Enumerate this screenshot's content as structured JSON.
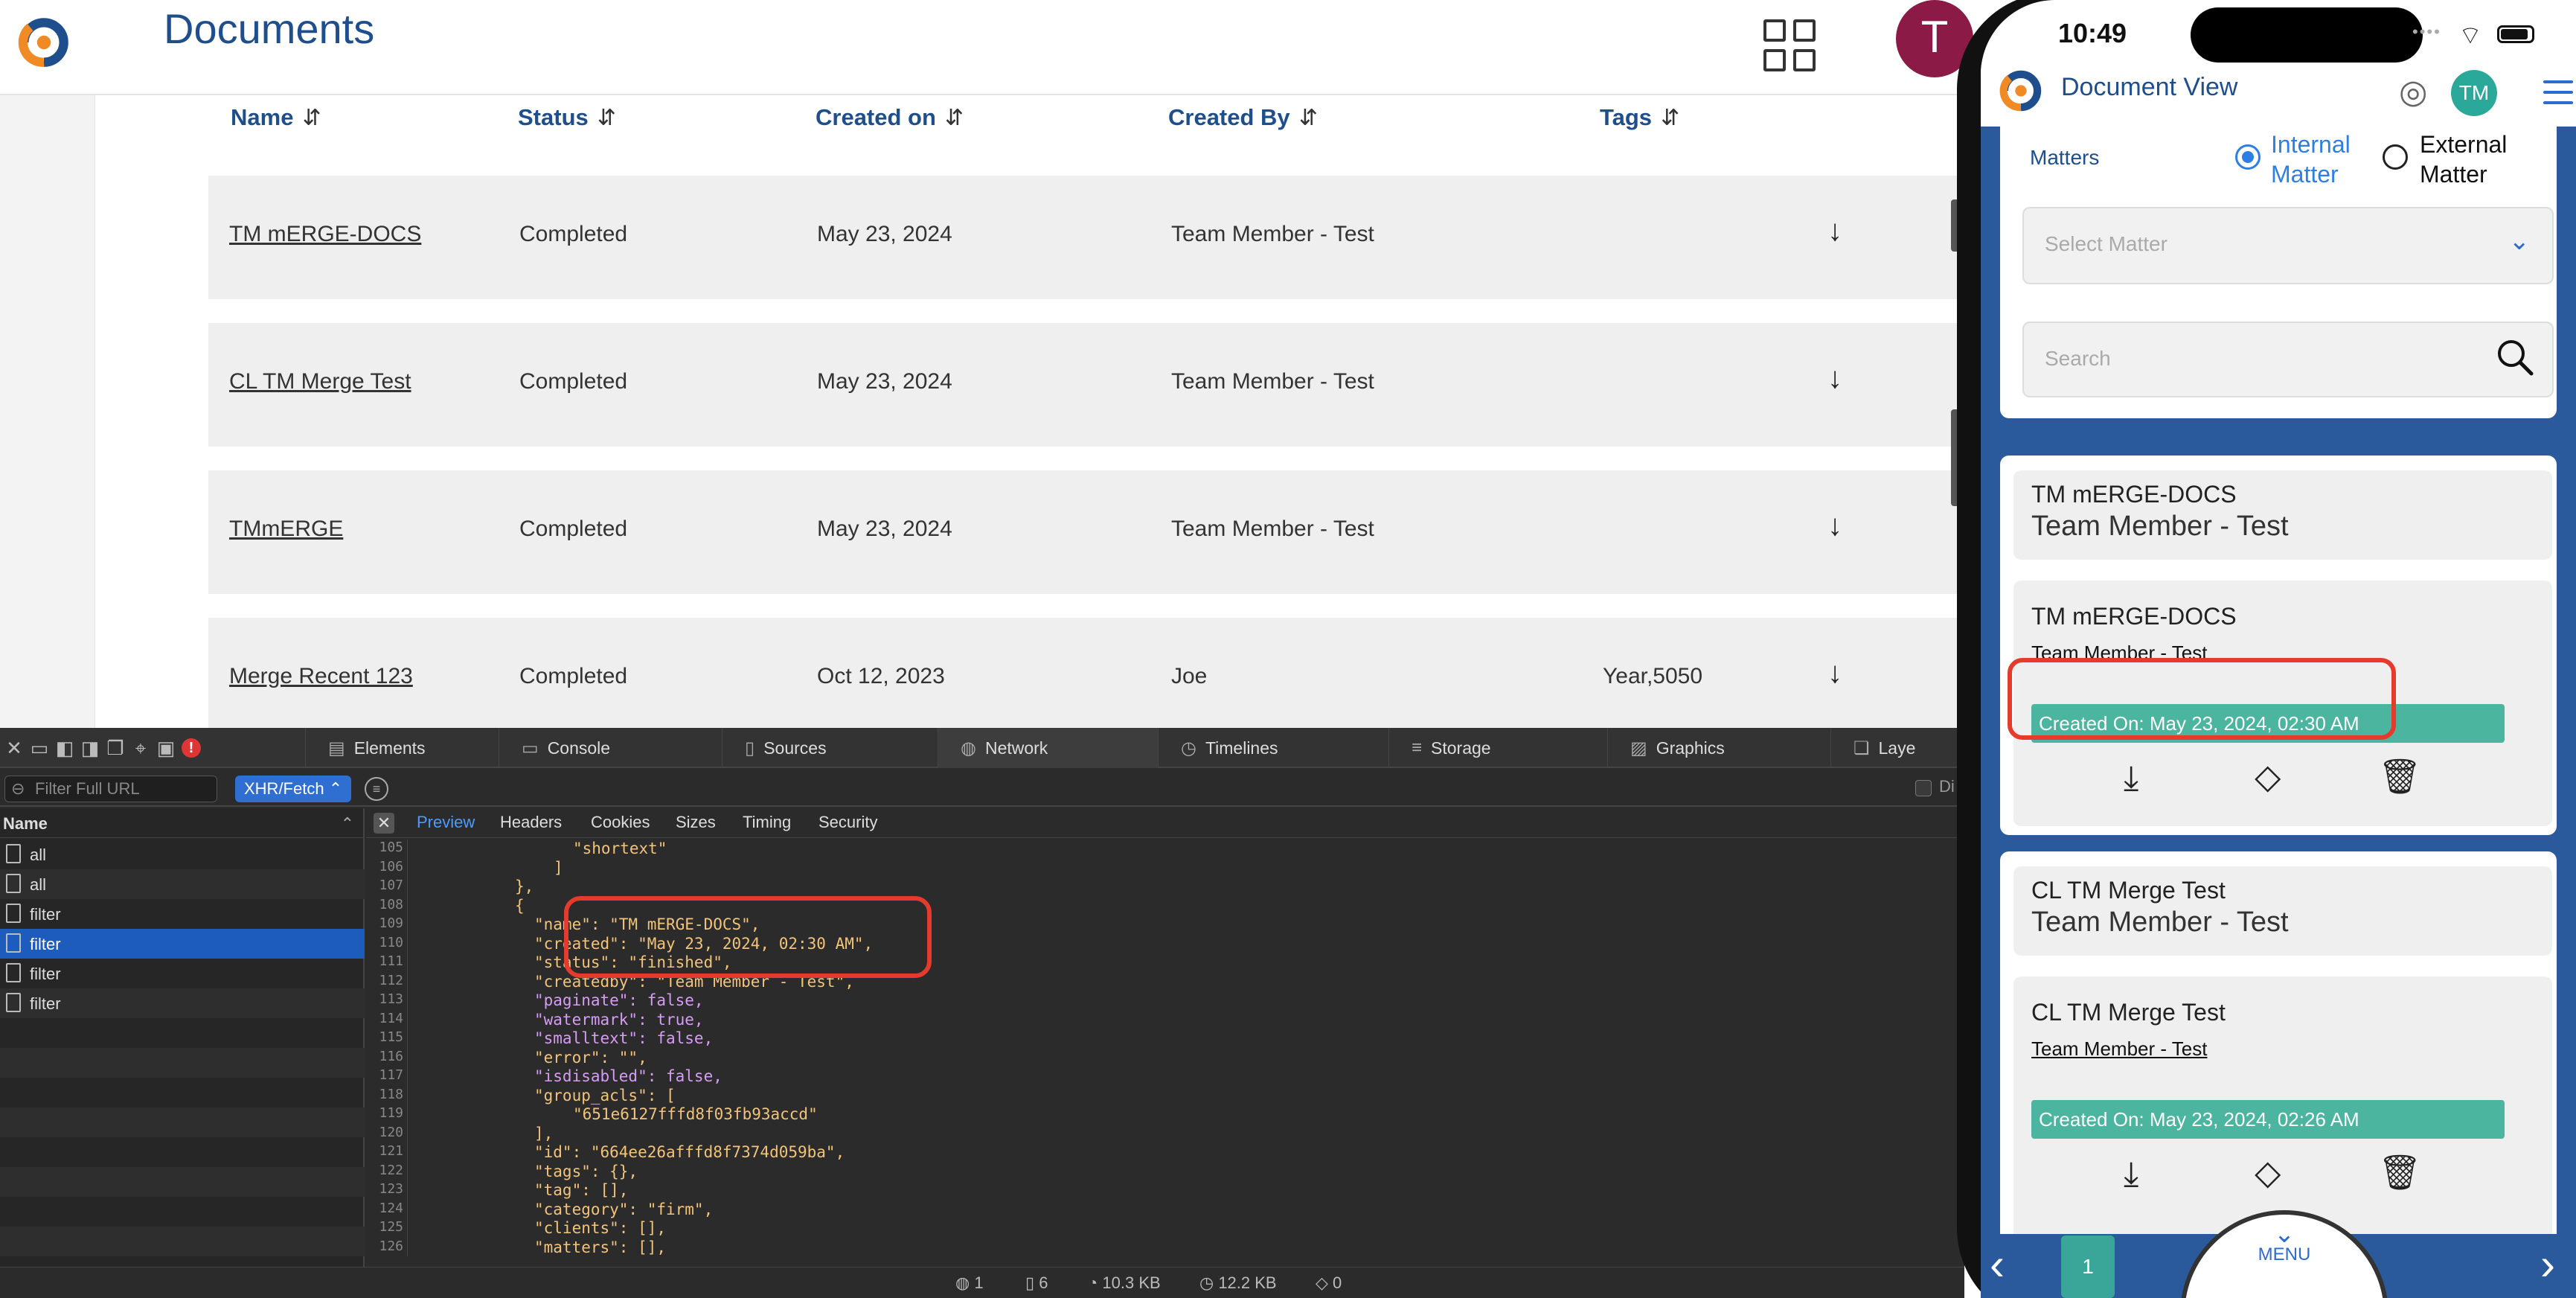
{
  "web": {
    "title": "Documents",
    "avatar_letter": "T",
    "columns": [
      "Name",
      "Status",
      "Created on",
      "Created By",
      "Tags"
    ],
    "sort_glyph": "⇵",
    "rows": [
      {
        "name": "TM mERGE-DOCS",
        "status": "Completed",
        "created": "May 23, 2024",
        "created_by": "Team Member - Test",
        "tags": ""
      },
      {
        "name": "CL TM Merge Test",
        "status": "Completed",
        "created": "May 23, 2024",
        "created_by": "Team Member - Test",
        "tags": ""
      },
      {
        "name": "TMmERGE",
        "status": "Completed",
        "created": "May 23, 2024",
        "created_by": "Team Member - Test",
        "tags": ""
      },
      {
        "name": "Merge Recent 123",
        "status": "Completed",
        "created": "Oct 12, 2023",
        "created_by": "Joe",
        "tags": "Year,5050"
      }
    ],
    "download_glyph": "↓"
  },
  "devtools": {
    "tabs": [
      "Elements",
      "Console",
      "Sources",
      "Network",
      "Timelines",
      "Storage",
      "Graphics",
      "Laye"
    ],
    "active_tab": "Network",
    "filter_placeholder": "Filter Full URL",
    "type_filter": "XHR/Fetch",
    "disable_label": "Di",
    "name_header": "Name",
    "requests": [
      "all",
      "all",
      "filter",
      "filter",
      "filter",
      "filter"
    ],
    "selected_request_index": 3,
    "preview_tabs": [
      "Preview",
      "Headers",
      "Cookies",
      "Sizes",
      "Timing",
      "Security"
    ],
    "active_preview_tab": "Preview",
    "code_lines": [
      {
        "n": "105",
        "text": "\"shortext\"",
        "indent": 8
      },
      {
        "n": "106",
        "text": "]",
        "indent": 7
      },
      {
        "n": "107",
        "text": "},",
        "indent": 5
      },
      {
        "n": "108",
        "text": "{",
        "indent": 5
      },
      {
        "n": "109",
        "text": "\"name\": \"TM mERGE-DOCS\",",
        "indent": 6
      },
      {
        "n": "110",
        "text": "\"created\": \"May 23, 2024, 02:30 AM\",",
        "indent": 6
      },
      {
        "n": "111",
        "text": "\"status\": \"finished\",",
        "indent": 6
      },
      {
        "n": "112",
        "text": "\"createdby\": \"Team Member - Test\",",
        "indent": 6
      },
      {
        "n": "113",
        "text": "\"paginate\": false,",
        "indent": 6
      },
      {
        "n": "114",
        "text": "\"watermark\": true,",
        "indent": 6
      },
      {
        "n": "115",
        "text": "\"smalltext\": false,",
        "indent": 6
      },
      {
        "n": "116",
        "text": "\"error\": \"\",",
        "indent": 6
      },
      {
        "n": "117",
        "text": "\"isdisabled\": false,",
        "indent": 6
      },
      {
        "n": "118",
        "text": "\"group_acls\": [",
        "indent": 6
      },
      {
        "n": "119",
        "text": "\"651e6127fffd8f03fb93accd\"",
        "indent": 8
      },
      {
        "n": "120",
        "text": "],",
        "indent": 6
      },
      {
        "n": "121",
        "text": "\"id\": \"664ee26afffd8f7374d059ba\",",
        "indent": 6
      },
      {
        "n": "122",
        "text": "\"tags\": {},",
        "indent": 6
      },
      {
        "n": "123",
        "text": "\"tag\": [],",
        "indent": 6
      },
      {
        "n": "124",
        "text": "\"category\": \"firm\",",
        "indent": 6
      },
      {
        "n": "125",
        "text": "\"clients\": [],",
        "indent": 6
      },
      {
        "n": "126",
        "text": "\"matters\": [],",
        "indent": 6
      }
    ],
    "status_items": [
      "1",
      "6",
      "10.3 KB",
      "12.2 KB",
      "0"
    ]
  },
  "phone": {
    "time": "10:49",
    "app_title": "Document View",
    "avatar": "TM",
    "matters_label": "Matters",
    "radio_internal": "Internal Matter",
    "radio_internal_l1": "Internal",
    "radio_internal_l2": "Matter",
    "radio_external_l1": "External",
    "radio_external_l2": "Matter",
    "select_placeholder": "Select Matter",
    "search_placeholder": "Search",
    "docs": [
      {
        "title": "TM mERGE-DOCS",
        "subtitle": "Team Member - Test",
        "inner_title": "TM mERGE-DOCS",
        "inner_sub": "Team Member - Test",
        "created": "Created On: May 23, 2024, 02:30 AM"
      },
      {
        "title": "CL TM Merge Test",
        "subtitle": "Team Member - Test",
        "inner_title": "CL TM Merge Test",
        "inner_sub": "Team Member - Test",
        "created": "Created On: May 23, 2024, 02:26 AM"
      }
    ],
    "page_number": "1",
    "menu_label": "MENU"
  }
}
